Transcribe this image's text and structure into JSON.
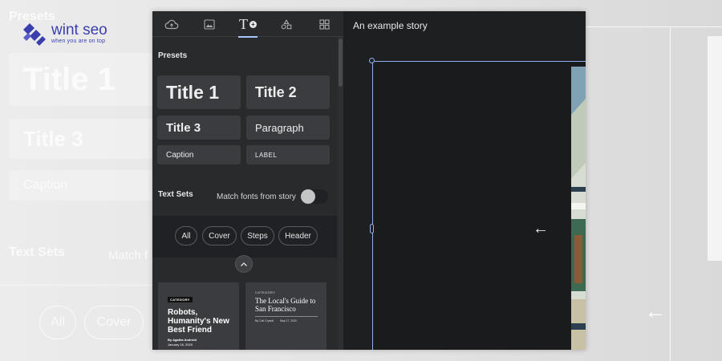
{
  "background": {
    "presets_heading": "Presets",
    "logo_name": "wint seo",
    "logo_tagline": "when you are on top",
    "title1": "Title 1",
    "title3": "Title 3",
    "caption": "Caption",
    "text_sets_heading": "Text Sets",
    "match_fragment": "Match f",
    "chip_all": "All",
    "chip_cover": "Cover",
    "arrow": "←"
  },
  "colors": {
    "panel": "#292a2c",
    "canvas": "#1e1f21",
    "tile": "#3b3c40",
    "accent": "#a8c7fa",
    "frame": "#8fb0ee",
    "logo": "#3b3fae"
  },
  "tabs": [
    {
      "icon": "upload-cloud-icon",
      "active": false
    },
    {
      "icon": "image-icon",
      "active": false
    },
    {
      "icon": "text-add-icon",
      "label": "T",
      "active": true
    },
    {
      "icon": "shapes-icon",
      "active": false
    },
    {
      "icon": "grid-icon",
      "active": false
    }
  ],
  "sidebar": {
    "presets_heading": "Presets",
    "presets": {
      "title1": "Title 1",
      "title2": "Title 2",
      "title3": "Title 3",
      "paragraph": "Paragraph",
      "caption": "Caption",
      "label": "LABEL"
    },
    "text_sets_heading": "Text Sets",
    "match_fonts_label": "Match fonts from story",
    "match_fonts_on": false,
    "filter_chips": [
      "All",
      "Cover",
      "Steps",
      "Header"
    ],
    "cards": [
      {
        "category": "CATEGORY",
        "title": "Robots, Humanity's New Best Friend",
        "author": "By Agatha Android",
        "date": "January 16, 2020"
      },
      {
        "category": "CATEGORY",
        "title": "The Local's Guide to San Francisco",
        "author": "By Cali Crystal",
        "date": "May 17, 2020"
      }
    ]
  },
  "canvas": {
    "story_title": "An example story",
    "nav_arrow": "←"
  }
}
